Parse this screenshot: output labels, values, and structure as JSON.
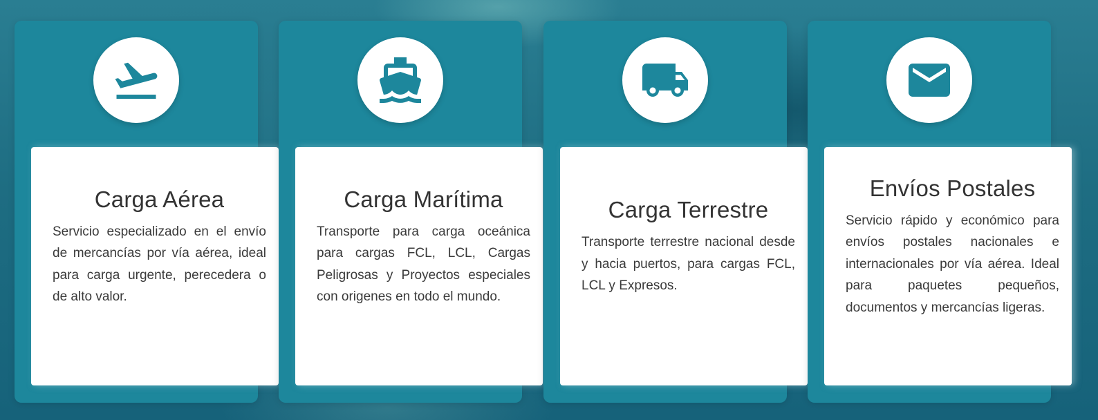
{
  "theme": {
    "accent": "#1d879c",
    "card_bg": "#ffffff",
    "text": "#333333"
  },
  "services": [
    {
      "icon": "airplane-takeoff-icon",
      "title": "Carga Aérea",
      "description": "Servicio especializado en el envío de mercancías por vía aérea, ideal para carga urgente, perecedera o de alto valor."
    },
    {
      "icon": "ship-icon",
      "title": "Carga Marítima",
      "description": "Transporte para carga oceánica para cargas FCL, LCL, Cargas Peligrosas y Proyectos especiales con origenes en todo el mundo."
    },
    {
      "icon": "truck-icon",
      "title": "Carga Terrestre",
      "description": "Transporte terrestre nacional desde y hacia puertos, para cargas FCL, LCL y Expresos."
    },
    {
      "icon": "envelope-icon",
      "title": "Envíos Postales",
      "description": "Servicio rápido y económico para envíos postales nacionales e internacionales por vía aérea. Ideal para paquetes pequeños, documentos y mercancías ligeras."
    }
  ]
}
